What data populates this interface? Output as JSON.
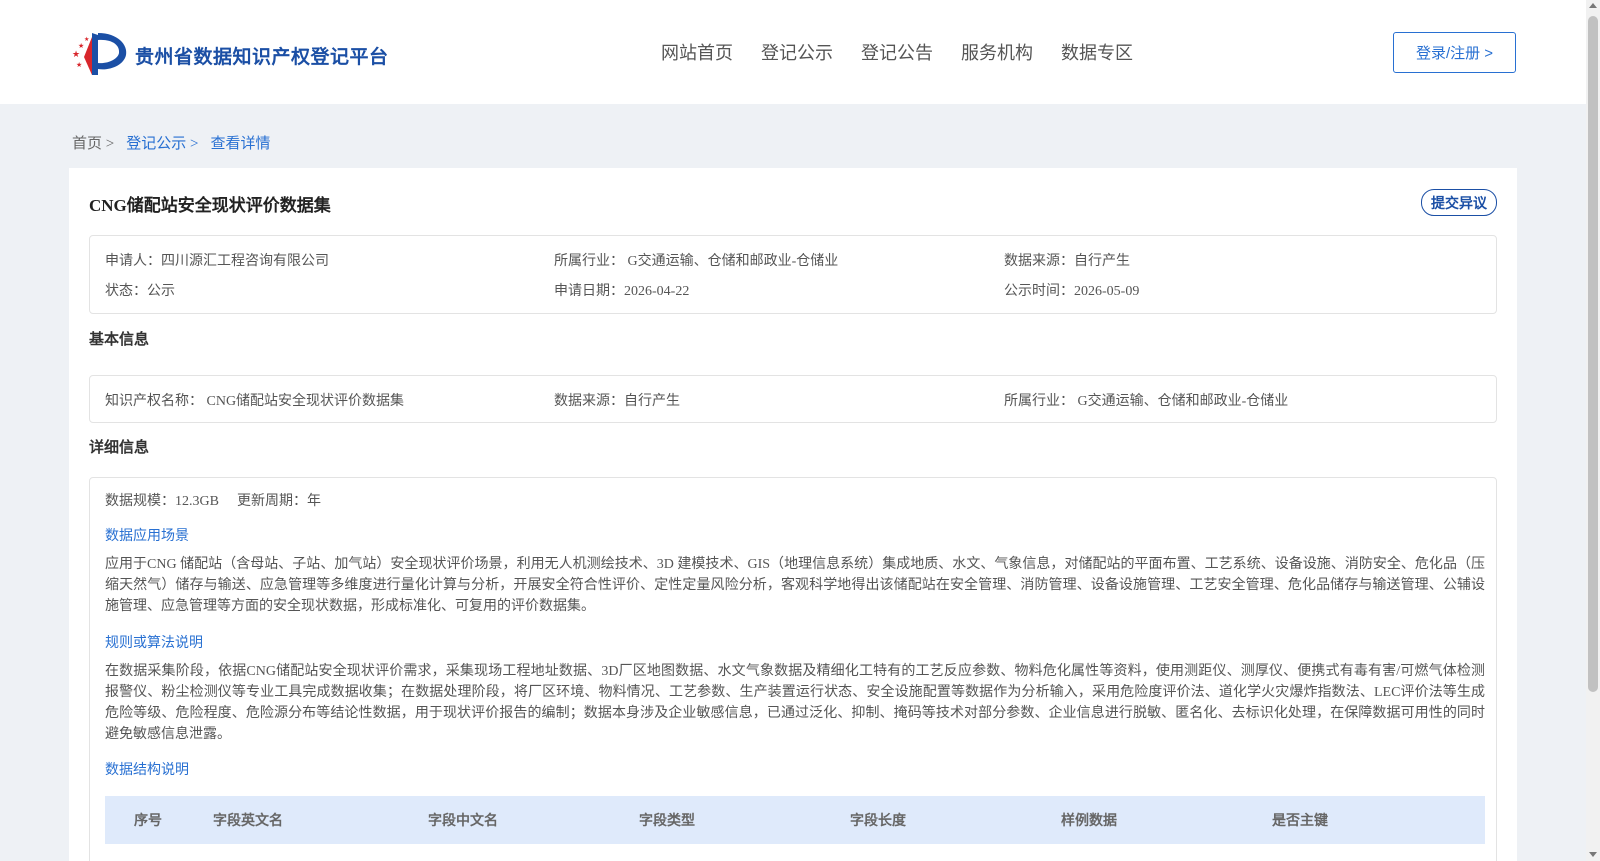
{
  "header": {
    "site_name": "贵州省数据知识产权登记平台",
    "nav": [
      "网站首页",
      "登记公示",
      "登记公告",
      "服务机构",
      "数据专区"
    ],
    "login_label": "登录/注册 >"
  },
  "breadcrumb": {
    "home": "首页 >",
    "section": "登记公示 >",
    "current": "查看详情"
  },
  "record": {
    "title": "CNG储配站安全现状评价数据集",
    "objection_label": "提交异议",
    "summary": {
      "applicant": "申请人：四川源汇工程咨询有限公司",
      "industry": "所属行业： G交通运输、仓储和邮政业-仓储业",
      "data_source": "数据来源：自行产生",
      "status": "状态：公示",
      "apply_date": "申请日期：2026-04-22",
      "publicity_time": "公示时间：2026-05-09"
    },
    "basic": {
      "heading": "基本信息",
      "ip_name": "知识产权名称： CNG储配站安全现状评价数据集",
      "data_source": "数据来源：自行产生",
      "industry": "所属行业： G交通运输、仓储和邮政业-仓储业"
    },
    "detail": {
      "heading": "详细信息",
      "scale": "数据规模：12.3GB",
      "update_cycle": "更新周期：年",
      "scenario_heading": "数据应用场景",
      "scenario_text": "应用于CNG 储配站（含母站、子站、加气站）安全现状评价场景，利用无人机测绘技术、3D 建模技术、GIS（地理信息系统）集成地质、水文、气象信息，对储配站的平面布置、工艺系统、设备设施、消防安全、危化品（压缩天然气）储存与输送、应急管理等多维度进行量化计算与分析，开展安全符合性评价、定性定量风险分析，客观科学地得出该储配站在安全管理、消防管理、设备设施管理、工艺安全管理、危化品储存与输送管理、公辅设施管理、应急管理等方面的安全现状数据，形成标准化、可复用的评价数据集。",
      "rules_heading": "规则或算法说明",
      "rules_text": "在数据采集阶段，依据CNG储配站安全现状评价需求，采集现场工程地址数据、3D厂区地图数据、水文气象数据及精细化工特有的工艺反应参数、物料危化属性等资料，使用测距仪、测厚仪、便携式有毒有害/可燃气体检测报警仪、粉尘检测仪等专业工具完成数据收集；在数据处理阶段，将厂区环境、物料情况、工艺参数、生产装置运行状态、安全设施配置等数据作为分析输入，采用危险度评价法、道化学火灾爆炸指数法、LEC评价法等生成危险等级、危险程度、危险源分布等结论性数据，用于现状评价报告的编制；数据本身涉及企业敏感信息，已通过泛化、抑制、掩码等技术对部分参数、企业信息进行脱敏、匿名化、去标识化处理，在保障数据可用性的同时避免敏感信息泄露。",
      "structure_heading": "数据结构说明",
      "table_headers": [
        "序号",
        "字段英文名",
        "字段中文名",
        "字段类型",
        "字段长度",
        "样例数据",
        "是否主键"
      ]
    }
  },
  "colors": {
    "brand": "#1b4fa5",
    "link": "#2870d2",
    "table_header_bg": "#dfeafb",
    "page_bg": "#eef1f5"
  }
}
